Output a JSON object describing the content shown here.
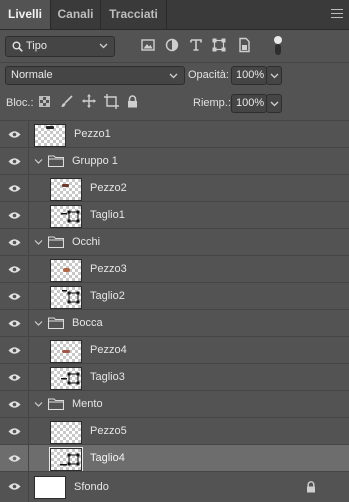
{
  "tabs": [
    {
      "label": "Livelli",
      "active": true
    },
    {
      "label": "Canali",
      "active": false
    },
    {
      "label": "Tracciati",
      "active": false
    }
  ],
  "filter": {
    "kind_label": "Tipo",
    "filter_icons": [
      "image-filter-icon",
      "adjustment-filter-icon",
      "text-filter-icon",
      "shape-filter-icon",
      "smart-object-filter-icon"
    ]
  },
  "blend": {
    "mode": "Normale",
    "opacity_label": "Opacità:",
    "opacity_value": "100%"
  },
  "lock": {
    "label": "Bloc.:",
    "fill_label": "Riemp.:",
    "fill_value": "100%"
  },
  "layers": [
    {
      "name": "Pezzo1",
      "type": "layer",
      "indent": 0
    },
    {
      "name": "Gruppo 1",
      "type": "group",
      "indent": 0
    },
    {
      "name": "Pezzo2",
      "type": "layer",
      "indent": 1
    },
    {
      "name": "Taglio1",
      "type": "shape",
      "indent": 1
    },
    {
      "name": "Occhi",
      "type": "group",
      "indent": 0
    },
    {
      "name": "Pezzo3",
      "type": "layer",
      "indent": 1
    },
    {
      "name": "Taglio2",
      "type": "shape",
      "indent": 1
    },
    {
      "name": "Bocca",
      "type": "group",
      "indent": 0
    },
    {
      "name": "Pezzo4",
      "type": "layer",
      "indent": 1
    },
    {
      "name": "Taglio3",
      "type": "shape",
      "indent": 1
    },
    {
      "name": "Mento",
      "type": "group",
      "indent": 0
    },
    {
      "name": "Pezzo5",
      "type": "layer",
      "indent": 1
    },
    {
      "name": "Taglio4",
      "type": "shape",
      "indent": 1,
      "selected": true
    },
    {
      "name": "Sfondo",
      "type": "background",
      "indent": 0,
      "locked": true
    }
  ],
  "colors": {
    "panel_bg": "#535353",
    "tab_bar": "#3a3a3a",
    "selected_row": "#6d6d6d"
  }
}
